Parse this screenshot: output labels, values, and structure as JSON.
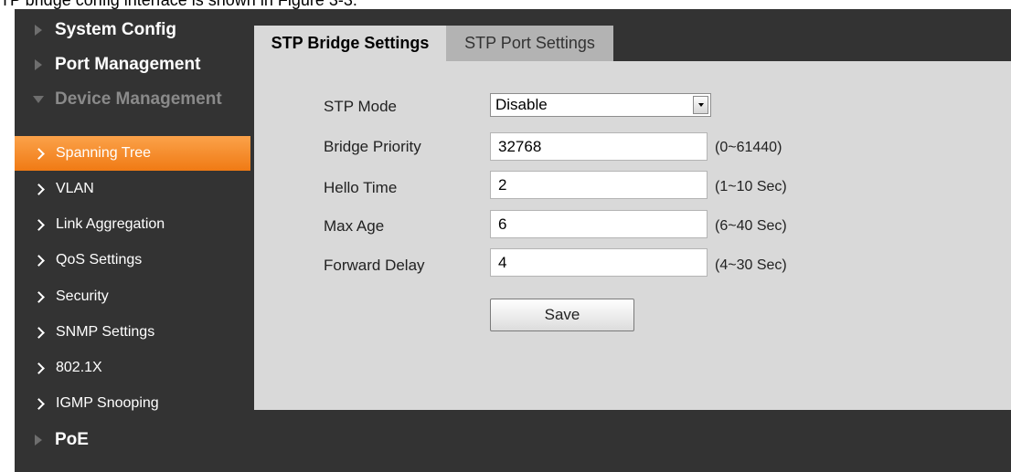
{
  "caption": "TP bridge config interface is shown in Figure 3-3.",
  "sidebar": {
    "sections": [
      {
        "label": "System Config",
        "icon": "triangle-right-icon"
      },
      {
        "label": "Port Management",
        "icon": "triangle-right-icon"
      },
      {
        "label": "Device Management",
        "icon": "triangle-down-icon"
      },
      {
        "label": "PoE",
        "icon": "triangle-right-icon"
      }
    ],
    "items": [
      {
        "label": "Spanning Tree",
        "active": true
      },
      {
        "label": "VLAN"
      },
      {
        "label": "Link Aggregation"
      },
      {
        "label": "QoS Settings"
      },
      {
        "label": "Security"
      },
      {
        "label": "SNMP Settings"
      },
      {
        "label": "802.1X"
      },
      {
        "label": "IGMP Snooping"
      }
    ]
  },
  "tabs": [
    {
      "label": "STP Bridge Settings",
      "active": true
    },
    {
      "label": "STP Port Settings",
      "active": false
    }
  ],
  "form": {
    "stp_mode": {
      "label": "STP Mode",
      "value": "Disable"
    },
    "bridge_priority": {
      "label": "Bridge Priority",
      "value": "32768",
      "range": "(0~61440)"
    },
    "hello_time": {
      "label": "Hello Time",
      "value": "2",
      "range": "(1~10 Sec)"
    },
    "max_age": {
      "label": "Max Age",
      "value": "6",
      "range": "(6~40 Sec)"
    },
    "forward_delay": {
      "label": "Forward Delay",
      "value": "4",
      "range": "(4~30 Sec)"
    },
    "save_label": "Save"
  },
  "colors": {
    "sidebar_bg": "#333333",
    "active_item": "#f58a20",
    "content_bg": "#d9d9d9"
  }
}
